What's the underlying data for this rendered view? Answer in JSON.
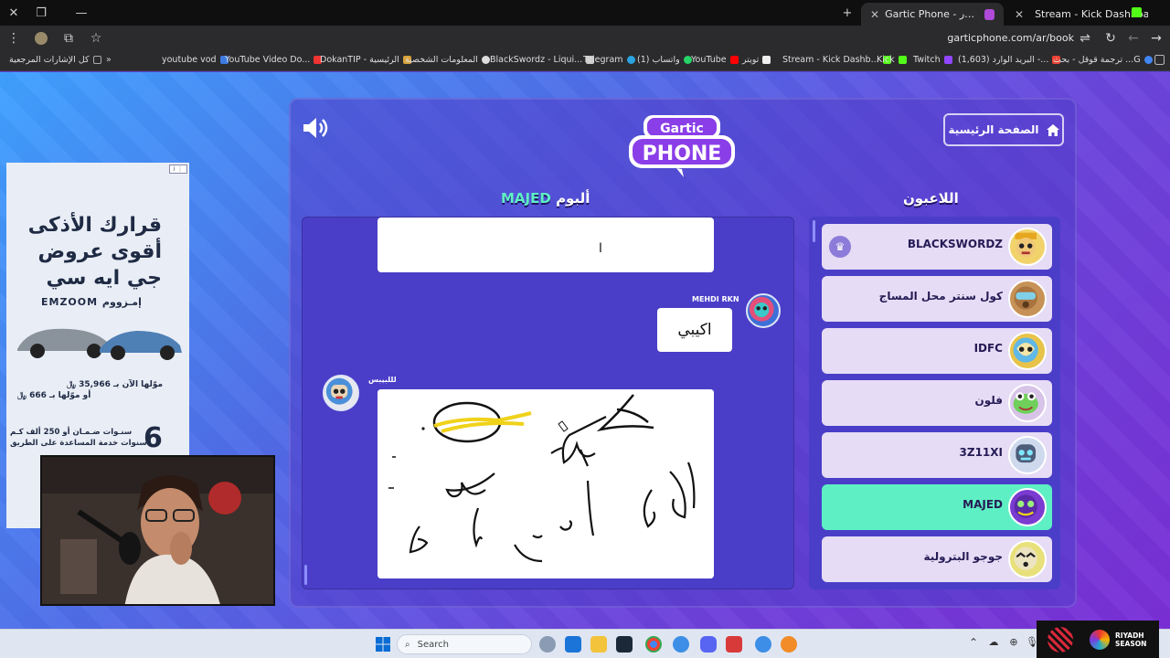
{
  "browser": {
    "tabs": [
      {
        "title": "Gartic Phone - الهاتف المكسور",
        "active": true
      },
      {
        "title": "Stream - Kick Dashboard",
        "active": false
      }
    ],
    "url": "garticphone.com/ar/book",
    "bookmarks": [
      {
        "label": "كل الإشارات المرجعية",
        "color": "#aaaaaa"
      },
      {
        "label": "youtube vod",
        "color": "#3d7be0"
      },
      {
        "label": "YouTube Video Do...",
        "color": "#e33"
      },
      {
        "label": "DokanTIP - الرئيسية",
        "color": "#d8a23a"
      },
      {
        "label": "المعلومات الشخصية",
        "color": "#ddd"
      },
      {
        "label": "BlackSwordz - Liqui...",
        "color": "#ccc"
      },
      {
        "label": "Telegram",
        "color": "#2aa3e0"
      },
      {
        "label": "(1) واتساب",
        "color": "#25d366"
      },
      {
        "label": "YouTube",
        "color": "#f00"
      },
      {
        "label": "تويتر",
        "color": "#eee"
      },
      {
        "label": "Stream - Kick Dashb...",
        "color": "#53fc18"
      },
      {
        "label": "Kick",
        "color": "#53fc18"
      },
      {
        "label": "Twitch",
        "color": "#9146ff"
      },
      {
        "label": "(1,603) البريد الوارد -...",
        "color": "#ea4335"
      },
      {
        "label": "ترجمة قوقل - بحث ...G",
        "color": "#4285f4"
      }
    ]
  },
  "game": {
    "home_button": "الصفحة الرئيسية",
    "logo_top": "Gartic",
    "logo_bottom": "PHONE",
    "players_title": "اللاعبون",
    "album_title_prefix": "ألبوم",
    "album_owner": "MAJED",
    "players": [
      {
        "name": "BLACKSWORDZ",
        "host": true,
        "active": false
      },
      {
        "name": "كول سنتر محل المساج",
        "host": false,
        "active": false
      },
      {
        "name": "IDFC",
        "host": false,
        "active": false
      },
      {
        "name": "فلون",
        "host": false,
        "active": false
      },
      {
        "name": "3Z11XI",
        "host": false,
        "active": false
      },
      {
        "name": "MAJED",
        "host": false,
        "active": true
      },
      {
        "name": "جوجو البترولية",
        "host": false,
        "active": false
      }
    ],
    "album": {
      "top_card_text": "ا",
      "entry1_author": "MEHDI RKN",
      "entry1_text": "اكيبي",
      "entry2_author": "لللبيبس"
    }
  },
  "ad": {
    "line1": "قرارك الأذكى",
    "line2": "أقوى عروض",
    "line3": "جي ايه سي",
    "brand": "EMZOOM إمـزووم",
    "price_a": "موّلها الآن بـ 35,966 ﷼",
    "price_b": "أو موّلها بـ 666 ﷼",
    "warranty_num": "6",
    "warranty_a": "سنـوات ضـمـان أو 250 ألف كـم",
    "warranty_b": "سنوات خدمة المساعدة على الطريق",
    "adchoice": "i ⋮"
  },
  "taskbar": {
    "search_placeholder": "Search"
  },
  "tray": {
    "riyadh_line1": "RIYADH",
    "riyadh_line2": "SEASON"
  }
}
